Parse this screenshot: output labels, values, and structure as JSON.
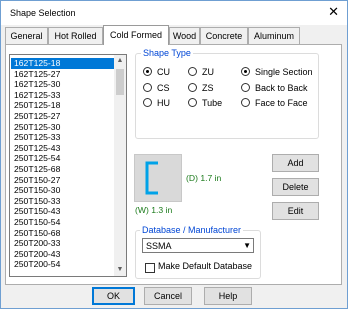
{
  "window": {
    "title": "Shape Selection",
    "close_glyph": "✕"
  },
  "tabs": [
    {
      "label": "General"
    },
    {
      "label": "Hot Rolled"
    },
    {
      "label": "Cold Formed"
    },
    {
      "label": "Wood"
    },
    {
      "label": "Concrete"
    },
    {
      "label": "Aluminum"
    }
  ],
  "active_tab": "Cold Formed",
  "shape_list": {
    "items": [
      "162T125-18",
      "162T125-27",
      "162T125-30",
      "162T125-33",
      "250T125-18",
      "250T125-27",
      "250T125-30",
      "250T125-33",
      "250T125-43",
      "250T125-54",
      "250T125-68",
      "250T150-27",
      "250T150-30",
      "250T150-33",
      "250T150-43",
      "250T150-54",
      "250T150-68",
      "250T200-33",
      "250T200-43",
      "250T200-54"
    ],
    "selected": "162T125-18",
    "scroll_up": "▲",
    "scroll_down": "▼"
  },
  "shape_type": {
    "title": "Shape Type",
    "options": [
      {
        "label": "CU",
        "checked": true
      },
      {
        "label": "ZU",
        "checked": false
      },
      {
        "label": "CS",
        "checked": false
      },
      {
        "label": "ZS",
        "checked": false
      },
      {
        "label": "HU",
        "checked": false
      },
      {
        "label": "Tube",
        "checked": false
      }
    ],
    "section_options": [
      {
        "label": "Single Section",
        "checked": true
      },
      {
        "label": "Back to Back",
        "checked": false
      },
      {
        "label": "Face to Face",
        "checked": false
      }
    ]
  },
  "preview": {
    "depth_label": "(D) 1.7 in",
    "width_label": "(W) 1.3 in",
    "shape_color": "#00a2e8"
  },
  "actions": {
    "add": "Add",
    "delete": "Delete",
    "edit": "Edit"
  },
  "database": {
    "title": "Database / Manufacturer",
    "selected": "SSMA",
    "make_default_label": "Make Default Database",
    "make_default_checked": false
  },
  "footer": {
    "ok": "OK",
    "cancel": "Cancel",
    "help": "Help"
  }
}
